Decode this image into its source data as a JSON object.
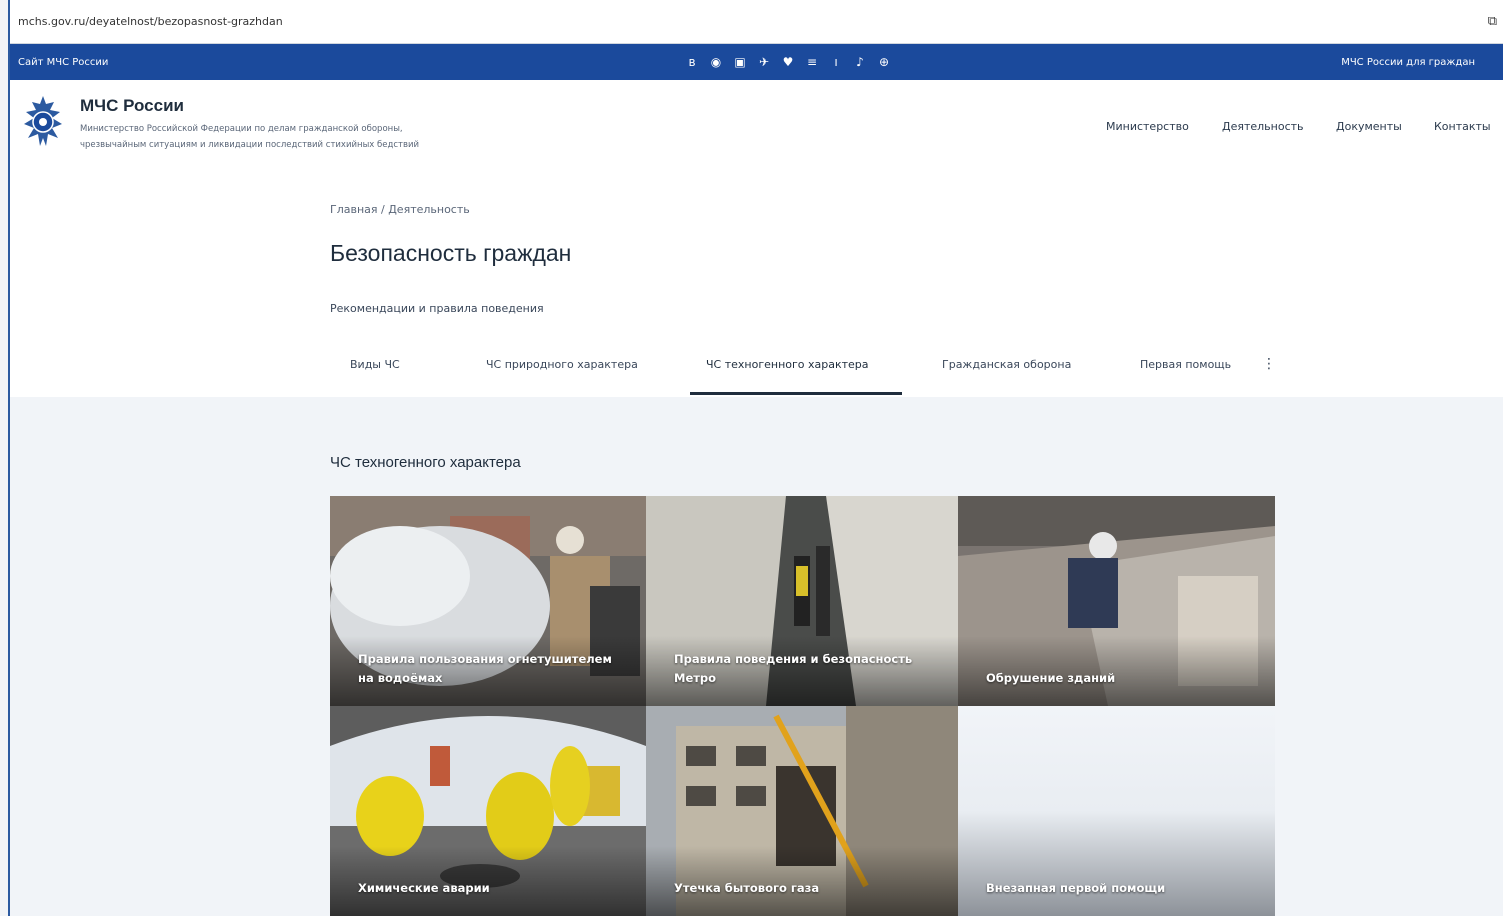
{
  "browser": {
    "url": "mchs.gov.ru/deyatelnost/bezopasnost-grazhdan",
    "extension_icon": "puzzle-icon"
  },
  "topbar": {
    "left_text": "Сайт МЧС России",
    "right_text": "МЧС России для граждан",
    "social_icons": [
      "vk-icon",
      "ok-icon",
      "youtube-icon",
      "telegram-icon",
      "rutube-icon",
      "dzen-icon",
      "livejournal-icon",
      "tiktok-icon",
      "yappy-icon"
    ],
    "social_glyphs": [
      "в",
      "◉",
      "▣",
      "✈",
      "♥",
      "≡",
      "ı",
      "♪",
      "⊕"
    ],
    "background": "#1b4a9c"
  },
  "header": {
    "title": "МЧС России",
    "subtitle_line1": "Министерство Российской Федерации по делам гражданской обороны,",
    "subtitle_line2": "чрезвычайным ситуациям и ликвидации последствий стихийных бедствий",
    "nav": [
      "Министерство",
      "Деятельность",
      "Документы",
      "Контакты"
    ]
  },
  "breadcrumb": "Главная / Деятельность",
  "page_title": "Безопасность граждан",
  "subtitle": "Рекомендации и правила поведения",
  "tabs": {
    "items": [
      "Виды ЧС",
      "ЧС природного характера",
      "ЧС техногенного характера",
      "Гражданская оборона",
      "Первая помощь"
    ],
    "active_index": 2
  },
  "section": {
    "title": "ЧС техногенного характера",
    "cards": [
      "Правила пользования огнетушителем на водоёмах",
      "Правила поведения и безопасность Метро",
      "Обрушение зданий",
      "Химические аварии",
      "Утечка бытового газа",
      "Внезапная первой помощи"
    ]
  },
  "colors": {
    "accent": "#1b4a9c",
    "content_bg": "#f1f4f8"
  }
}
